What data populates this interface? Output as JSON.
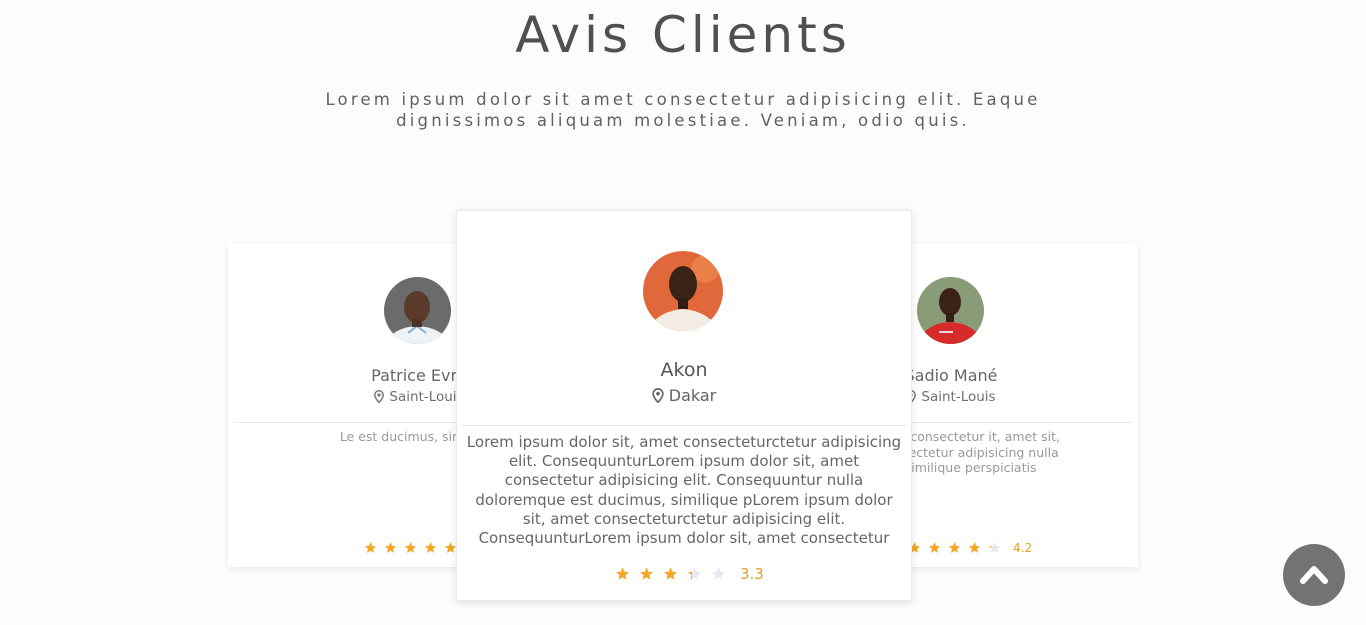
{
  "section": {
    "title": "Avis Clients",
    "subtitle": "Lorem ipsum dolor sit amet consectetur adipisicing elit. Eaque dignissimos aliquam molestiae. Veniam, odio quis."
  },
  "testimonials": [
    {
      "name": "Patrice Evra",
      "location": "Saint-Louis",
      "location_icon": "map-pin-icon",
      "review": "Le est ducimus, similique",
      "rating": 5,
      "rating_label": ""
    },
    {
      "name": "Akon",
      "location": "Dakar",
      "location_icon": "map-pin-icon",
      "review": "Lorem ipsum dolor sit, amet consecteturctetur adipisicing elit. ConsequunturLorem ipsum dolor sit, amet consectetur adipisicing elit. Consequuntur nulla doloremque est ducimus, similique pLorem ipsum dolor sit, amet consecteturctetur adipisicing elit. ConsequunturLorem ipsum dolor sit, amet consectetur",
      "rating": 3.3,
      "rating_label": "3.3"
    },
    {
      "name": "Sadio Mané",
      "location": "Saint-Louis",
      "location_icon": "map-pin-icon",
      "review": "r sit, amet consectetur it, amet sit, amet consectetur adipisicing nulla doloresimilique perspiciatis",
      "rating": 4.2,
      "rating_label": "4.2"
    }
  ],
  "carousel": {
    "slides": 3,
    "active_index": 2
  },
  "back_to_top": {
    "icon": "chevron-up-icon"
  },
  "colors": {
    "star_filled": "#f5a623",
    "star_empty": "#e6e9ef",
    "rating_text": "#e9a023",
    "button_bg": "#737373"
  }
}
